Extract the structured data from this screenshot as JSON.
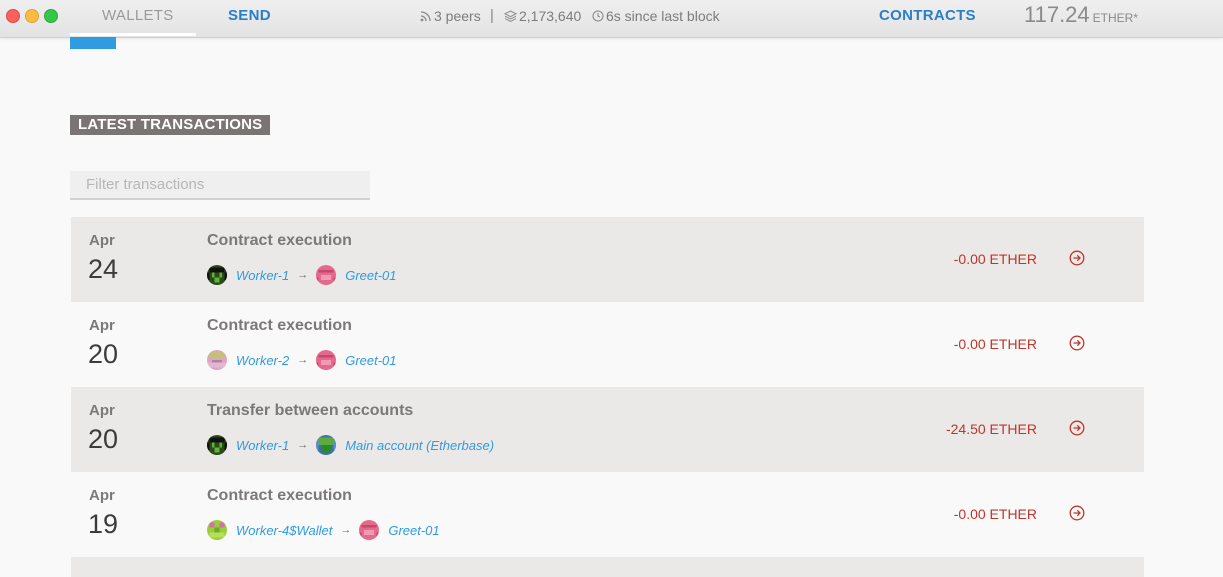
{
  "nav": {
    "wallets": "WALLETS",
    "send": "SEND",
    "contracts": "CONTRACTS"
  },
  "status": {
    "peers": "3 peers",
    "separator": "|",
    "blocks": "2,173,640",
    "last_block": "6s since last block"
  },
  "balance": {
    "amount": "117.24",
    "unit": "ETHER*"
  },
  "transactions_section": {
    "title": "LATEST TRANSACTIONS",
    "filter_placeholder": "Filter transactions"
  },
  "transactions": [
    {
      "month": "Apr",
      "day": "24",
      "title": "Contract execution",
      "from": "Worker-1",
      "to": "Greet-01",
      "amount": "-0.00 ETHER"
    },
    {
      "month": "Apr",
      "day": "20",
      "title": "Contract execution",
      "from": "Worker-2",
      "to": "Greet-01",
      "amount": "-0.00 ETHER"
    },
    {
      "month": "Apr",
      "day": "20",
      "title": "Transfer between accounts",
      "from": "Worker-1",
      "to": "Main account (Etherbase)",
      "amount": "-24.50 ETHER"
    },
    {
      "month": "Apr",
      "day": "19",
      "title": "Contract execution",
      "from": "Worker-4$Wallet",
      "to": "Greet-01",
      "amount": "-0.00 ETHER"
    }
  ],
  "colors": {
    "accent_blue": "#2f9be0",
    "negative_red": "#c0352b",
    "heading_bg": "#7a7474"
  }
}
